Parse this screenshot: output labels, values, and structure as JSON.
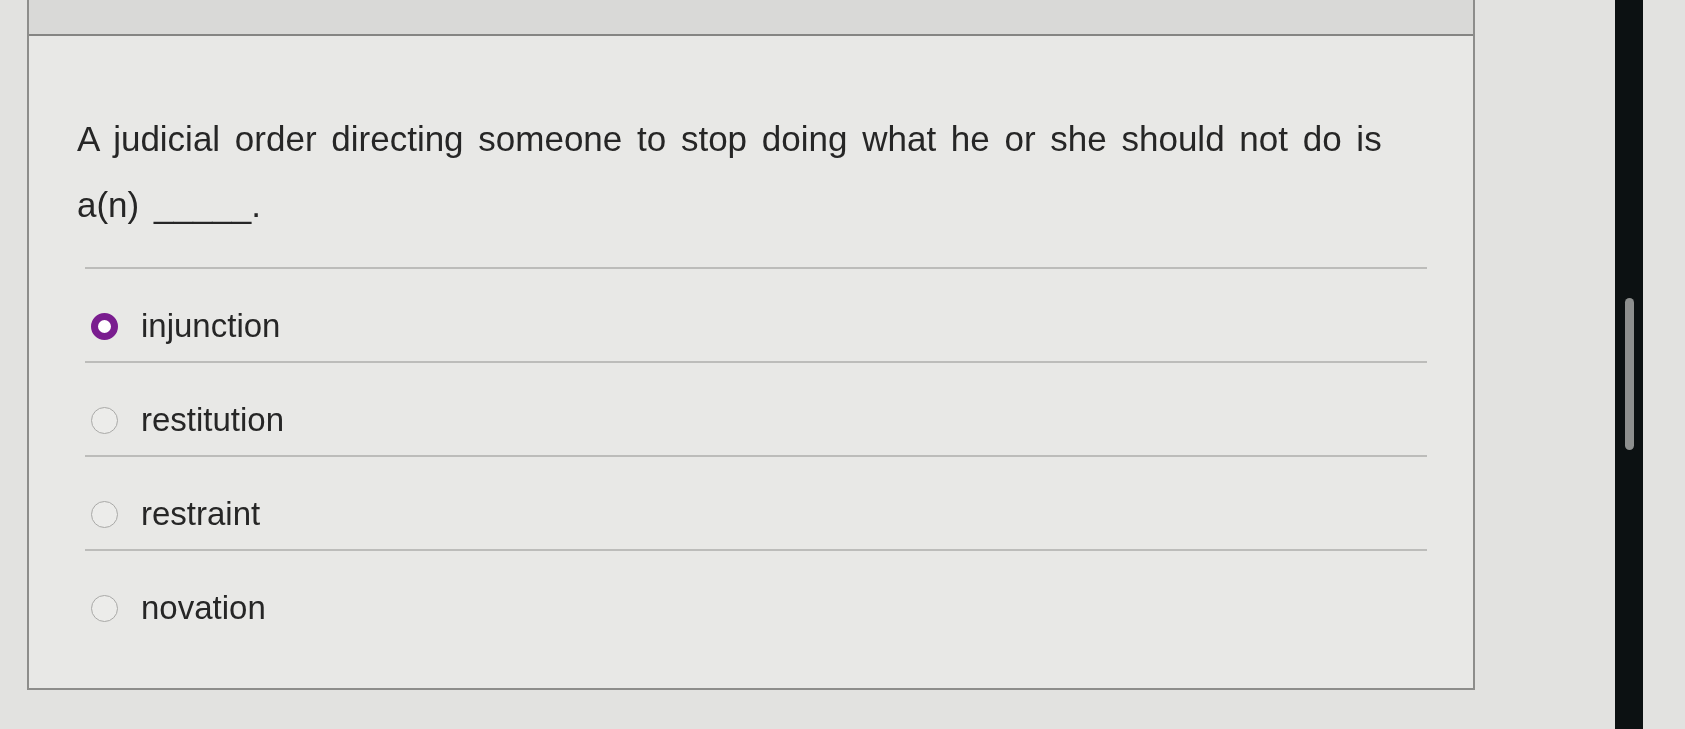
{
  "question": {
    "text": "A judicial order directing someone to stop doing what he or she should not do is a(n) _____."
  },
  "options": [
    {
      "label": "injunction",
      "selected": true
    },
    {
      "label": "restitution",
      "selected": false
    },
    {
      "label": "restraint",
      "selected": false
    },
    {
      "label": "novation",
      "selected": false
    }
  ]
}
